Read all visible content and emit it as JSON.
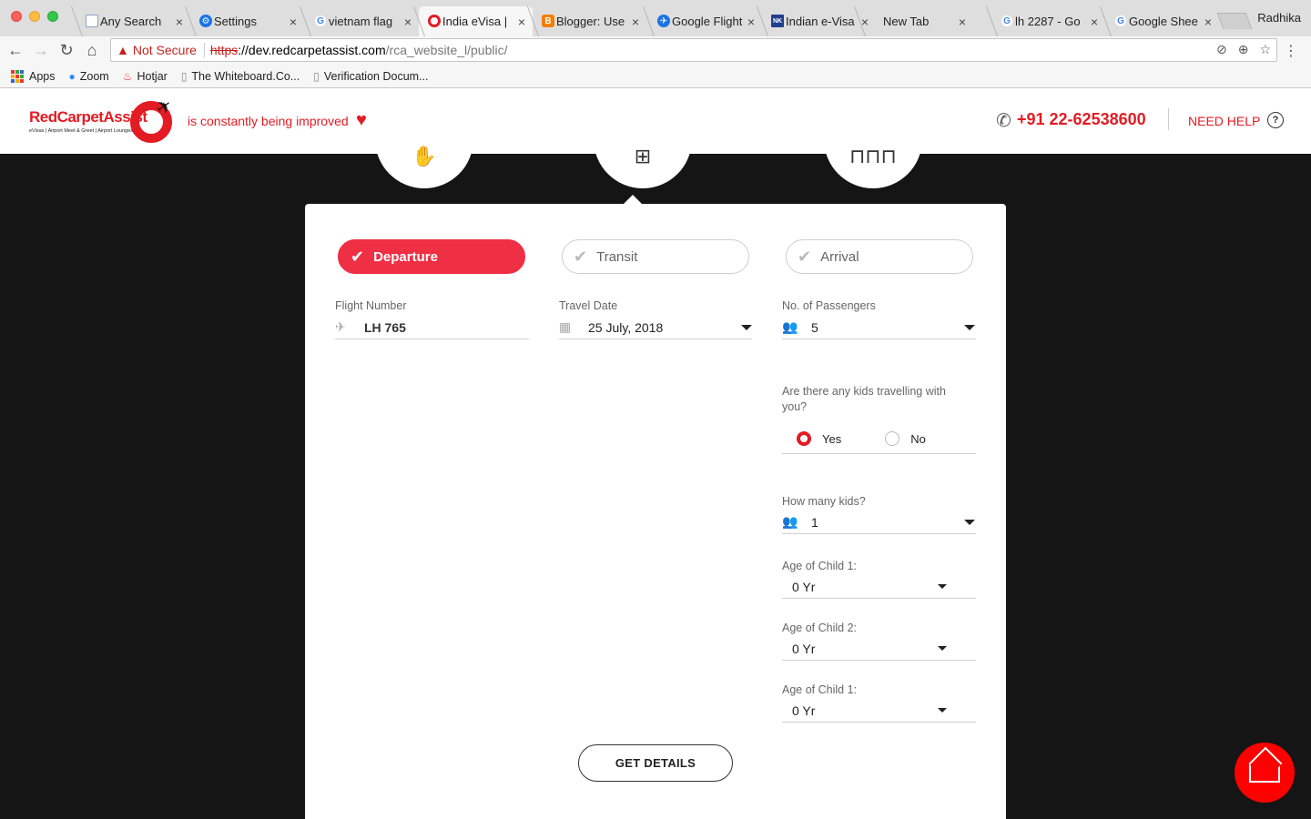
{
  "browser": {
    "tabs": [
      {
        "label": "Any Search",
        "fav": "doc",
        "color": "#6b8fbf"
      },
      {
        "label": "Settings",
        "fav": "gear",
        "color": "#1a73e8"
      },
      {
        "label": "vietnam flag",
        "fav": "G",
        "color": "#4285f4"
      },
      {
        "label": "India eVisa |",
        "fav": "ring",
        "color": "#e31b23"
      },
      {
        "label": "Blogger: Use",
        "fav": "B",
        "color": "#f57d00"
      },
      {
        "label": "Google Flight",
        "fav": "plane",
        "color": "#1a73e8"
      },
      {
        "label": "Indian e-Visa",
        "fav": "NK",
        "color": "#1f3f8f"
      },
      {
        "label": "New Tab",
        "fav": "",
        "color": ""
      },
      {
        "label": "lh 2287 - Go",
        "fav": "G",
        "color": "#4285f4"
      },
      {
        "label": "Google Shee",
        "fav": "G",
        "color": "#4285f4"
      }
    ],
    "active_tab": 3,
    "close_glyph": "×",
    "profile_name": "Radhika",
    "not_secure_label": "Not Secure",
    "url_scheme": "https",
    "url_host": "://dev.redcarpetassist.com",
    "url_path": "/rca_website_l/public/",
    "bookmarks": [
      {
        "label": "Apps"
      },
      {
        "label": "Zoom"
      },
      {
        "label": "Hotjar"
      },
      {
        "label": "The Whiteboard.Co..."
      },
      {
        "label": "Verification Docum..."
      }
    ]
  },
  "header": {
    "logo_text": "RedCarpetAssist",
    "logo_sub": "eVisas | Airport Meet & Greet | Airport Lounges",
    "tagline": "is constantly being improved",
    "phone": "+91 22-62538600",
    "need_help": "NEED HELP",
    "help_glyph": "?",
    "brand_color": "#e31b23"
  },
  "form": {
    "segments": [
      {
        "label": "Departure",
        "selected": true
      },
      {
        "label": "Transit",
        "selected": false
      },
      {
        "label": "Arrival",
        "selected": false
      }
    ],
    "flight_number": {
      "label": "Flight Number",
      "value": "LH 765"
    },
    "travel_date": {
      "label": "Travel Date",
      "value": "25 July, 2018"
    },
    "passengers": {
      "label": "No. of Passengers",
      "value": "5"
    },
    "kids_question": "Are there any kids travelling with you?",
    "kids_options": {
      "yes": "Yes",
      "no": "No",
      "selected": "yes"
    },
    "how_many_kids": {
      "label": "How many kids?",
      "value": "1"
    },
    "children": [
      {
        "label": "Age of Child 1:",
        "value": "0 Yr"
      },
      {
        "label": "Age of Child 2:",
        "value": "0 Yr"
      },
      {
        "label": "Age of Child 1:",
        "value": "0 Yr"
      }
    ],
    "submit_label": "GET DETAILS",
    "accent_color": "#ef2f44"
  }
}
